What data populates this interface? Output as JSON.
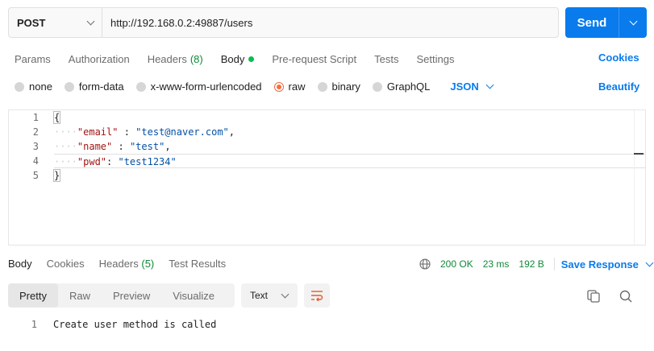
{
  "request": {
    "method": "POST",
    "url": "http://192.168.0.2:49887/users",
    "send_label": "Send"
  },
  "tabs": {
    "params": "Params",
    "authorization": "Authorization",
    "headers": "Headers",
    "headers_count": "(8)",
    "body": "Body",
    "prerequest": "Pre-request Script",
    "tests": "Tests",
    "settings": "Settings",
    "cookies": "Cookies"
  },
  "body_types": {
    "none": "none",
    "form_data": "form-data",
    "urlencoded": "x-www-form-urlencoded",
    "raw": "raw",
    "binary": "binary",
    "graphql": "GraphQL",
    "language": "JSON",
    "beautify": "Beautify"
  },
  "editor": {
    "line_numbers": [
      "1",
      "2",
      "3",
      "4",
      "5"
    ],
    "open_brace": "{",
    "close_brace": "}",
    "fields": [
      {
        "key": "\"email\"",
        "sep": " : ",
        "value": "\"test@naver.com\"",
        "trail": ","
      },
      {
        "key": "\"name\"",
        "sep": " : ",
        "value": "\"test\"",
        "trail": ","
      },
      {
        "key": "\"pwd\"",
        "sep": ": ",
        "value": "\"test1234\"",
        "trail": ""
      }
    ]
  },
  "response": {
    "tabs": {
      "body": "Body",
      "cookies": "Cookies",
      "headers": "Headers",
      "headers_count": "(5)",
      "test_results": "Test Results"
    },
    "status": "200 OK",
    "time": "23 ms",
    "size": "192 B",
    "save_label": "Save Response",
    "views": {
      "pretty": "Pretty",
      "raw": "Raw",
      "preview": "Preview",
      "visualize": "Visualize"
    },
    "format": "Text",
    "body_lines": [
      {
        "num": "1",
        "text": "Create user method is called"
      }
    ]
  },
  "colors": {
    "accent": "#097bed",
    "success": "#0f8a3a",
    "raw_selected": "#ff6c37"
  }
}
